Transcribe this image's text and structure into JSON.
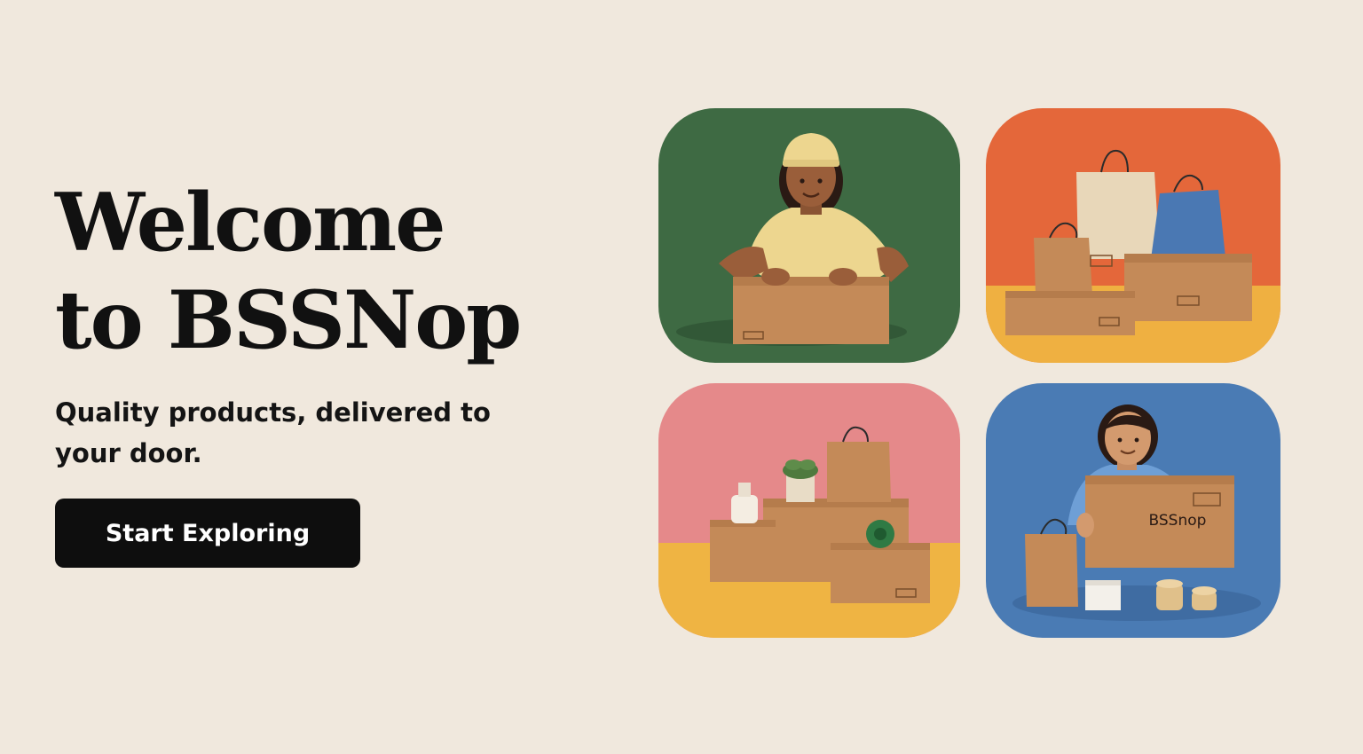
{
  "hero": {
    "title_line1": "Welcome",
    "title_line2": "to BSSNop",
    "subtitle": "Quality products, delivered to your door.",
    "cta_label": "Start Exploring"
  },
  "tiles": [
    {
      "illustration": "delivery-person-with-box",
      "background": "#3E6A43"
    },
    {
      "illustration": "shopping-bags-and-boxes",
      "background": "#E4673A",
      "floor": "#EFB041"
    },
    {
      "illustration": "boxes-plant-and-bottle",
      "background": "#E5898A",
      "floor": "#EFB443"
    },
    {
      "illustration": "person-holding-branded-box",
      "background": "#4A7BB4",
      "box_label": "BSSnop"
    }
  ],
  "colors": {
    "page_background": "#F0E8DD",
    "text": "#111111",
    "button": "#0E0E0E",
    "button_text": "#FFFFFF",
    "cardboard": "#C48A58"
  }
}
